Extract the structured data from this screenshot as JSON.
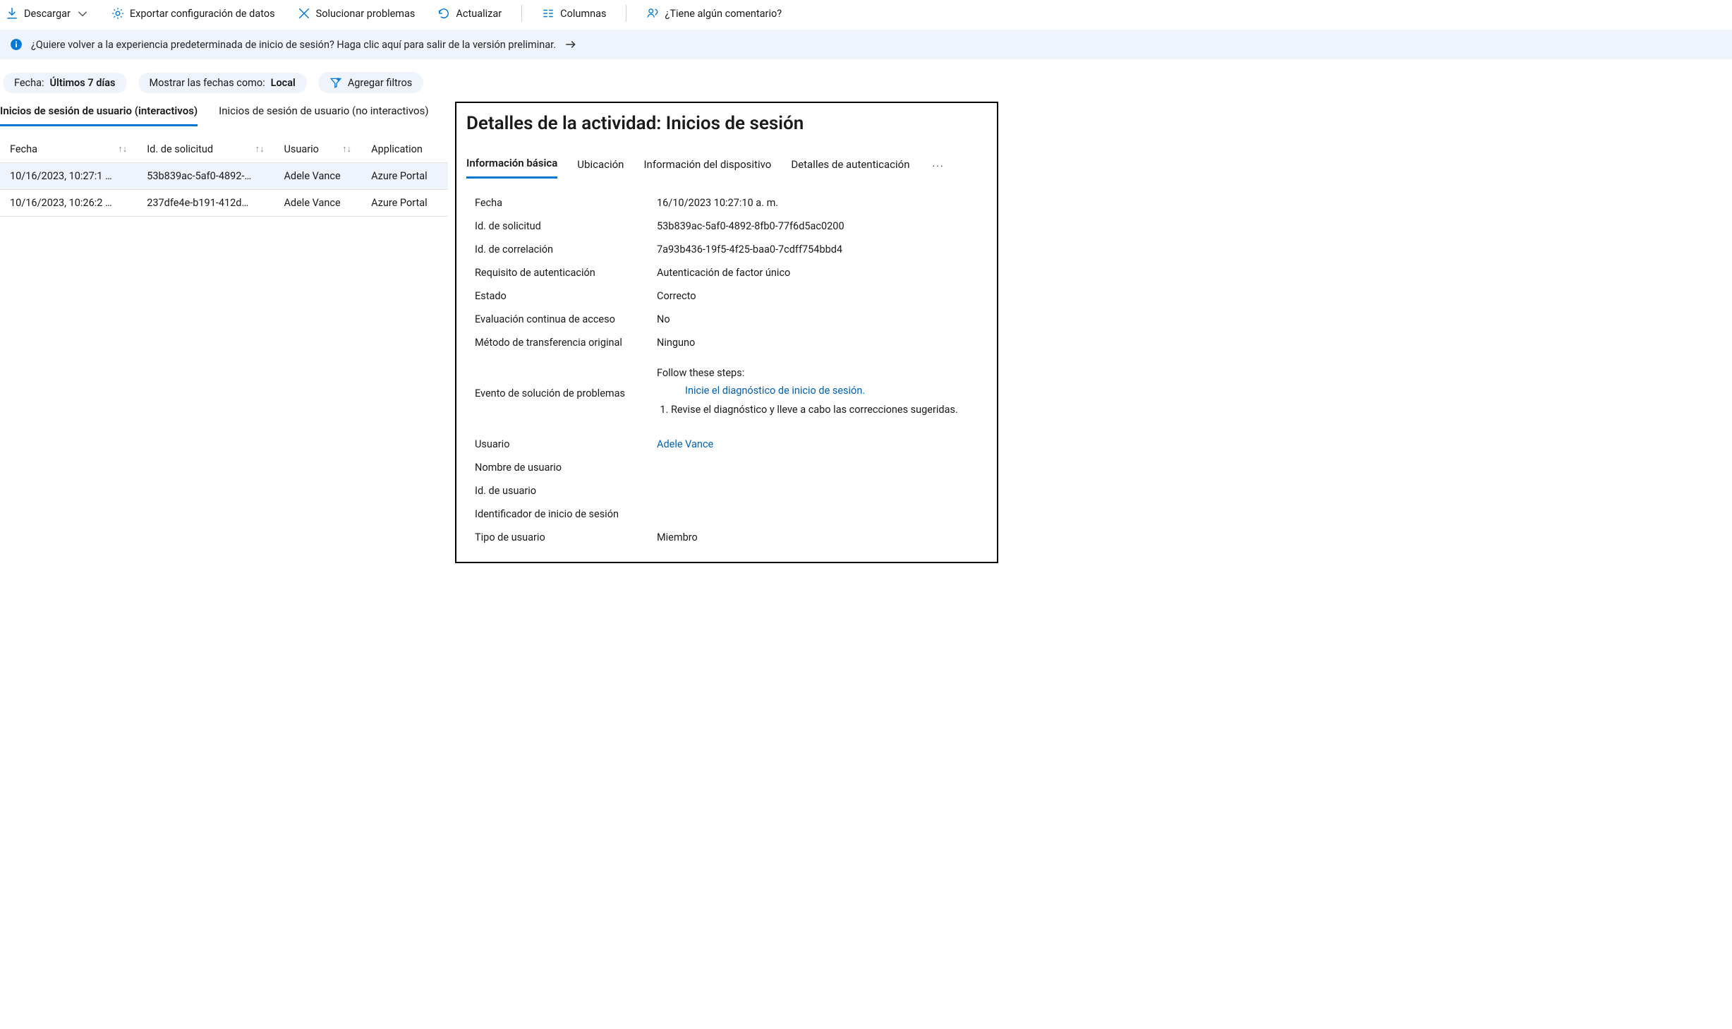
{
  "toolbar": {
    "download": "Descargar",
    "export": "Exportar configuración de datos",
    "troubleshoot": "Solucionar problemas",
    "refresh": "Actualizar",
    "columns": "Columnas",
    "feedback": "¿Tiene algún comentario?"
  },
  "info_bar": {
    "text": "¿Quiere volver a la experiencia predeterminada de inicio de sesión? Haga clic aquí para salir de la versión preliminar."
  },
  "filters": {
    "date_label": "Fecha: ",
    "date_value": "Últimos 7 días",
    "dates_as_label": "Mostrar las fechas como: ",
    "dates_as_value": "Local",
    "add_filters": "Agregar filtros"
  },
  "left_tabs": {
    "interactive": "Inicios de sesión de usuario (interactivos)",
    "noninteractive": "Inicios de sesión de usuario (no interactivos)"
  },
  "grid": {
    "columns": {
      "date": "Fecha",
      "request_id": "Id. de solicitud",
      "user": "Usuario",
      "application": "Application"
    },
    "rows": [
      {
        "date": "10/16/2023, 10:27:1 …",
        "request_id": "53b839ac-5af0-4892-…",
        "user": "Adele Vance",
        "application": "Azure Portal",
        "selected": true
      },
      {
        "date": "10/16/2023, 10:26:2 …",
        "request_id": "237dfe4e-b191-412d…",
        "user": "Adele Vance",
        "application": "Azure Portal",
        "selected": false
      }
    ]
  },
  "details": {
    "title": "Detalles de la actividad: Inicios de sesión",
    "tabs": {
      "basic": "Información básica",
      "location": "Ubicación",
      "device": "Información del dispositivo",
      "auth": "Detalles de autenticación"
    },
    "fields": {
      "date_label": "Fecha",
      "date_value": "16/10/2023 10:27:10 a. m.",
      "request_id_label": "Id. de solicitud",
      "request_id_value": "53b839ac-5af0-4892-8fb0-77f6d5ac0200",
      "correlation_id_label": "Id. de correlación",
      "correlation_id_value": "7a93b436-19f5-4f25-baa0-7cdff754bbd4",
      "auth_req_label": "Requisito de autenticación",
      "auth_req_value": "Autenticación de factor único",
      "status_label": "Estado",
      "status_value": "Correcto",
      "cae_label": "Evaluación continua de acceso",
      "cae_value": "No",
      "orig_transfer_label": "Método de transferencia original",
      "orig_transfer_value": "Ninguno",
      "troubleshoot_label": "Evento de solución de problemas",
      "troubleshoot_intro": "Follow these steps:",
      "troubleshoot_link": "Inicie el diagnóstico de inicio de sesión.",
      "troubleshoot_step1": "Revise el diagnóstico y lleve a cabo las correcciones sugeridas.",
      "user_label": "Usuario",
      "user_value": "Adele Vance",
      "username_label": "Nombre de usuario",
      "username_value": "",
      "user_id_label": "Id. de usuario",
      "user_id_value": "",
      "signin_ident_label": "Identificador de inicio de sesión",
      "signin_ident_value": "",
      "user_type_label": "Tipo de usuario",
      "user_type_value": "Miembro"
    }
  }
}
